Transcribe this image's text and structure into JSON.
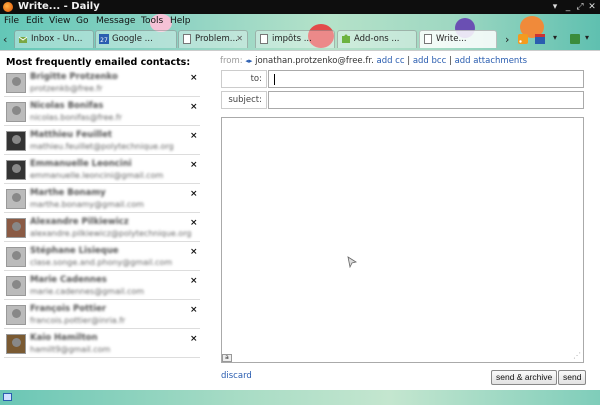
{
  "window": {
    "title": "Write... - Daily"
  },
  "menu": [
    {
      "label": "File",
      "key": "F"
    },
    {
      "label": "Edit",
      "key": "E"
    },
    {
      "label": "View",
      "key": "V"
    },
    {
      "label": "Go",
      "key": "G"
    },
    {
      "label": "Message",
      "key": "M"
    },
    {
      "label": "Tools",
      "key": "T"
    },
    {
      "label": "Help",
      "key": "H"
    }
  ],
  "tabs": [
    {
      "label": "Inbox - Un...",
      "icon": "inbox-icon"
    },
    {
      "label": "Google ...",
      "icon": "calendar-icon",
      "badge": "27"
    },
    {
      "label": "Problem...",
      "icon": "page-icon"
    },
    {
      "label": "impôts ...",
      "icon": "page-icon"
    },
    {
      "label": "Add-ons ...",
      "icon": "puzzle-icon"
    },
    {
      "label": "Write...",
      "icon": "page-icon"
    }
  ],
  "sidebar": {
    "heading": "Most frequently emailed contacts:",
    "remove_label": "×",
    "contacts": [
      {
        "name": "Brigitte Protzenko",
        "email": "protzenkb@free.fr"
      },
      {
        "name": "Nicolas Bonifas",
        "email": "nicolas.bonifas@free.fr"
      },
      {
        "name": "Matthieu Feuillet",
        "email": "mathieu.feuillet@polytechnique.org"
      },
      {
        "name": "Emmanuelle Leoncini",
        "email": "emmanuelle.leoncini@gmail.com"
      },
      {
        "name": "Marthe Bonamy",
        "email": "marthe.bonamy@gmail.com"
      },
      {
        "name": "Alexandre Pilkiewicz",
        "email": "alexandre.pilkiewicz@polytechnique.org"
      },
      {
        "name": "Stéphane Lisieque",
        "email": "clase.songe.and.phony@gmail.com"
      },
      {
        "name": "Marie Cadennes",
        "email": "marie.cadennes@gmail.com"
      },
      {
        "name": "François Pottier",
        "email": "francois.pottier@inria.fr"
      },
      {
        "name": "Kaio Hamilton",
        "email": "hamilt9@gmail.com"
      }
    ]
  },
  "compose": {
    "from_label": "from:",
    "from_address": "jonathan.protzenko@free.fr.",
    "add_cc": "add cc",
    "add_bcc": "add bcc",
    "add_attachments": "add attachments",
    "separator": "|",
    "to_label": "to:",
    "subject_label": "subject:",
    "to_value": "",
    "subject_value": "",
    "discard": "discard",
    "send_archive": "send & archive",
    "send": "send",
    "spell_icon": "spellcheck-icon"
  },
  "colors": {
    "link": "#2a5db0",
    "theme_teal": "#63c7b7",
    "titlebar": "#0e0e0e"
  }
}
